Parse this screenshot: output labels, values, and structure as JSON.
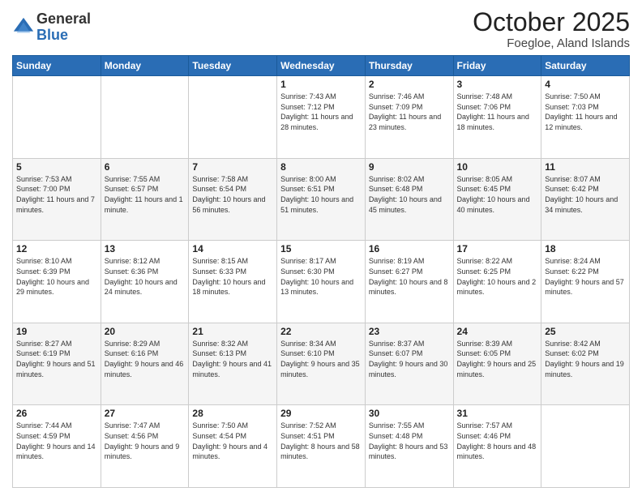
{
  "logo": {
    "general": "General",
    "blue": "Blue"
  },
  "header": {
    "month": "October 2025",
    "location": "Foegloe, Aland Islands"
  },
  "days_of_week": [
    "Sunday",
    "Monday",
    "Tuesday",
    "Wednesday",
    "Thursday",
    "Friday",
    "Saturday"
  ],
  "weeks": [
    [
      {
        "day": "",
        "sunrise": "",
        "sunset": "",
        "daylight": ""
      },
      {
        "day": "",
        "sunrise": "",
        "sunset": "",
        "daylight": ""
      },
      {
        "day": "",
        "sunrise": "",
        "sunset": "",
        "daylight": ""
      },
      {
        "day": "1",
        "sunrise": "Sunrise: 7:43 AM",
        "sunset": "Sunset: 7:12 PM",
        "daylight": "Daylight: 11 hours and 28 minutes."
      },
      {
        "day": "2",
        "sunrise": "Sunrise: 7:46 AM",
        "sunset": "Sunset: 7:09 PM",
        "daylight": "Daylight: 11 hours and 23 minutes."
      },
      {
        "day": "3",
        "sunrise": "Sunrise: 7:48 AM",
        "sunset": "Sunset: 7:06 PM",
        "daylight": "Daylight: 11 hours and 18 minutes."
      },
      {
        "day": "4",
        "sunrise": "Sunrise: 7:50 AM",
        "sunset": "Sunset: 7:03 PM",
        "daylight": "Daylight: 11 hours and 12 minutes."
      }
    ],
    [
      {
        "day": "5",
        "sunrise": "Sunrise: 7:53 AM",
        "sunset": "Sunset: 7:00 PM",
        "daylight": "Daylight: 11 hours and 7 minutes."
      },
      {
        "day": "6",
        "sunrise": "Sunrise: 7:55 AM",
        "sunset": "Sunset: 6:57 PM",
        "daylight": "Daylight: 11 hours and 1 minute."
      },
      {
        "day": "7",
        "sunrise": "Sunrise: 7:58 AM",
        "sunset": "Sunset: 6:54 PM",
        "daylight": "Daylight: 10 hours and 56 minutes."
      },
      {
        "day": "8",
        "sunrise": "Sunrise: 8:00 AM",
        "sunset": "Sunset: 6:51 PM",
        "daylight": "Daylight: 10 hours and 51 minutes."
      },
      {
        "day": "9",
        "sunrise": "Sunrise: 8:02 AM",
        "sunset": "Sunset: 6:48 PM",
        "daylight": "Daylight: 10 hours and 45 minutes."
      },
      {
        "day": "10",
        "sunrise": "Sunrise: 8:05 AM",
        "sunset": "Sunset: 6:45 PM",
        "daylight": "Daylight: 10 hours and 40 minutes."
      },
      {
        "day": "11",
        "sunrise": "Sunrise: 8:07 AM",
        "sunset": "Sunset: 6:42 PM",
        "daylight": "Daylight: 10 hours and 34 minutes."
      }
    ],
    [
      {
        "day": "12",
        "sunrise": "Sunrise: 8:10 AM",
        "sunset": "Sunset: 6:39 PM",
        "daylight": "Daylight: 10 hours and 29 minutes."
      },
      {
        "day": "13",
        "sunrise": "Sunrise: 8:12 AM",
        "sunset": "Sunset: 6:36 PM",
        "daylight": "Daylight: 10 hours and 24 minutes."
      },
      {
        "day": "14",
        "sunrise": "Sunrise: 8:15 AM",
        "sunset": "Sunset: 6:33 PM",
        "daylight": "Daylight: 10 hours and 18 minutes."
      },
      {
        "day": "15",
        "sunrise": "Sunrise: 8:17 AM",
        "sunset": "Sunset: 6:30 PM",
        "daylight": "Daylight: 10 hours and 13 minutes."
      },
      {
        "day": "16",
        "sunrise": "Sunrise: 8:19 AM",
        "sunset": "Sunset: 6:27 PM",
        "daylight": "Daylight: 10 hours and 8 minutes."
      },
      {
        "day": "17",
        "sunrise": "Sunrise: 8:22 AM",
        "sunset": "Sunset: 6:25 PM",
        "daylight": "Daylight: 10 hours and 2 minutes."
      },
      {
        "day": "18",
        "sunrise": "Sunrise: 8:24 AM",
        "sunset": "Sunset: 6:22 PM",
        "daylight": "Daylight: 9 hours and 57 minutes."
      }
    ],
    [
      {
        "day": "19",
        "sunrise": "Sunrise: 8:27 AM",
        "sunset": "Sunset: 6:19 PM",
        "daylight": "Daylight: 9 hours and 51 minutes."
      },
      {
        "day": "20",
        "sunrise": "Sunrise: 8:29 AM",
        "sunset": "Sunset: 6:16 PM",
        "daylight": "Daylight: 9 hours and 46 minutes."
      },
      {
        "day": "21",
        "sunrise": "Sunrise: 8:32 AM",
        "sunset": "Sunset: 6:13 PM",
        "daylight": "Daylight: 9 hours and 41 minutes."
      },
      {
        "day": "22",
        "sunrise": "Sunrise: 8:34 AM",
        "sunset": "Sunset: 6:10 PM",
        "daylight": "Daylight: 9 hours and 35 minutes."
      },
      {
        "day": "23",
        "sunrise": "Sunrise: 8:37 AM",
        "sunset": "Sunset: 6:07 PM",
        "daylight": "Daylight: 9 hours and 30 minutes."
      },
      {
        "day": "24",
        "sunrise": "Sunrise: 8:39 AM",
        "sunset": "Sunset: 6:05 PM",
        "daylight": "Daylight: 9 hours and 25 minutes."
      },
      {
        "day": "25",
        "sunrise": "Sunrise: 8:42 AM",
        "sunset": "Sunset: 6:02 PM",
        "daylight": "Daylight: 9 hours and 19 minutes."
      }
    ],
    [
      {
        "day": "26",
        "sunrise": "Sunrise: 7:44 AM",
        "sunset": "Sunset: 4:59 PM",
        "daylight": "Daylight: 9 hours and 14 minutes."
      },
      {
        "day": "27",
        "sunrise": "Sunrise: 7:47 AM",
        "sunset": "Sunset: 4:56 PM",
        "daylight": "Daylight: 9 hours and 9 minutes."
      },
      {
        "day": "28",
        "sunrise": "Sunrise: 7:50 AM",
        "sunset": "Sunset: 4:54 PM",
        "daylight": "Daylight: 9 hours and 4 minutes."
      },
      {
        "day": "29",
        "sunrise": "Sunrise: 7:52 AM",
        "sunset": "Sunset: 4:51 PM",
        "daylight": "Daylight: 8 hours and 58 minutes."
      },
      {
        "day": "30",
        "sunrise": "Sunrise: 7:55 AM",
        "sunset": "Sunset: 4:48 PM",
        "daylight": "Daylight: 8 hours and 53 minutes."
      },
      {
        "day": "31",
        "sunrise": "Sunrise: 7:57 AM",
        "sunset": "Sunset: 4:46 PM",
        "daylight": "Daylight: 8 hours and 48 minutes."
      },
      {
        "day": "",
        "sunrise": "",
        "sunset": "",
        "daylight": ""
      }
    ]
  ]
}
